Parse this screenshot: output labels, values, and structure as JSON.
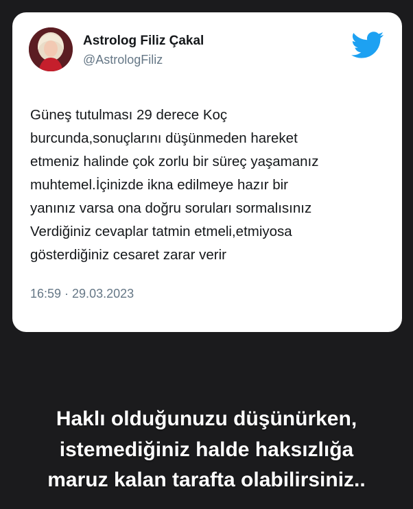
{
  "tweet": {
    "display_name": "Astrolog Filiz Çakal",
    "handle": "@AstrologFiliz",
    "lines": [
      "Güneş tutulması 29 derece Koç",
      "burcunda,sonuçlarını düşünmeden hareket",
      "etmeniz halinde çok zorlu bir süreç yaşamanız",
      "muhtemel.İçinizde ikna edilmeye hazır bir",
      "yanınız varsa ona doğru soruları sormalısınız",
      "Verdiğiniz cevaplar tatmin etmeli,etmiyosa",
      "gösterdiğiniz cesaret zarar verir"
    ],
    "timestamp": "16:59 · 29.03.2023",
    "brand_icon": "twitter-bird-icon",
    "brand_color": "#1da1f2"
  },
  "caption": {
    "lines": [
      "Haklı olduğunuzu düşünürken,",
      "istemediğiniz halde haksızlığa",
      "maruz kalan tarafta olabilirsiniz.."
    ]
  },
  "colors": {
    "background": "#1b1b1d",
    "card": "#ffffff",
    "text_primary": "#14171a",
    "text_secondary": "#657786",
    "caption_text": "#ffffff"
  }
}
